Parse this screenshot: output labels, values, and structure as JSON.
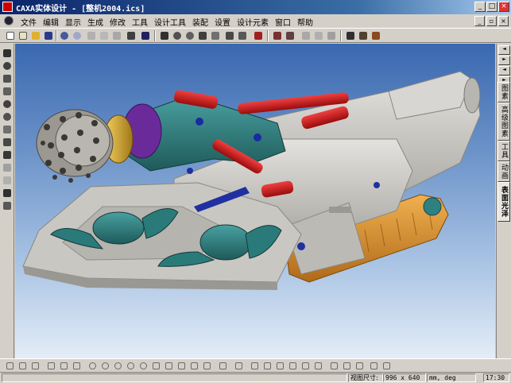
{
  "window": {
    "title": "CAXA实体设计 - [整机2004.ics]",
    "controls": [
      "_",
      "□",
      "×"
    ]
  },
  "menubar": {
    "items": [
      "文件",
      "编辑",
      "显示",
      "生成",
      "修改",
      "工具",
      "设计工具",
      "装配",
      "设置",
      "设计元素",
      "窗口",
      "帮助"
    ],
    "mdi_controls": [
      "_",
      "▫",
      "×"
    ]
  },
  "right_panel": {
    "arrows": [
      "◄",
      "►",
      "◄",
      "►"
    ],
    "tabs": [
      "图素",
      "高级图素",
      "工具",
      "动画",
      "表面光泽"
    ],
    "active_tab": "表面光泽"
  },
  "statusbar": {
    "view_size_label": "视图尺寸:",
    "view_size_value": "996 x 640",
    "units": "mm, deg",
    "time": "17:30"
  },
  "colors": {
    "titlebar_start": "#0a246a",
    "viewport_top": "#3a68b0",
    "viewport_bottom": "#e4edf7",
    "machine_body": "#c9c7c2",
    "arm": "#2f8080",
    "cylinder": "#d01818",
    "track": "#d8902a",
    "cutter": "#9a9890"
  }
}
